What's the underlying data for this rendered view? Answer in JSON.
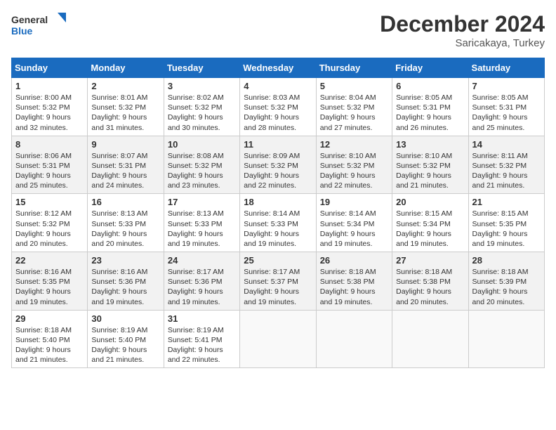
{
  "header": {
    "logo_line1": "General",
    "logo_line2": "Blue",
    "month": "December 2024",
    "location": "Saricakaya, Turkey"
  },
  "weekdays": [
    "Sunday",
    "Monday",
    "Tuesday",
    "Wednesday",
    "Thursday",
    "Friday",
    "Saturday"
  ],
  "weeks": [
    [
      {
        "day": "1",
        "lines": [
          "Sunrise: 8:00 AM",
          "Sunset: 5:32 PM",
          "Daylight: 9 hours",
          "and 32 minutes."
        ]
      },
      {
        "day": "2",
        "lines": [
          "Sunrise: 8:01 AM",
          "Sunset: 5:32 PM",
          "Daylight: 9 hours",
          "and 31 minutes."
        ]
      },
      {
        "day": "3",
        "lines": [
          "Sunrise: 8:02 AM",
          "Sunset: 5:32 PM",
          "Daylight: 9 hours",
          "and 30 minutes."
        ]
      },
      {
        "day": "4",
        "lines": [
          "Sunrise: 8:03 AM",
          "Sunset: 5:32 PM",
          "Daylight: 9 hours",
          "and 28 minutes."
        ]
      },
      {
        "day": "5",
        "lines": [
          "Sunrise: 8:04 AM",
          "Sunset: 5:32 PM",
          "Daylight: 9 hours",
          "and 27 minutes."
        ]
      },
      {
        "day": "6",
        "lines": [
          "Sunrise: 8:05 AM",
          "Sunset: 5:31 PM",
          "Daylight: 9 hours",
          "and 26 minutes."
        ]
      },
      {
        "day": "7",
        "lines": [
          "Sunrise: 8:05 AM",
          "Sunset: 5:31 PM",
          "Daylight: 9 hours",
          "and 25 minutes."
        ]
      }
    ],
    [
      {
        "day": "8",
        "lines": [
          "Sunrise: 8:06 AM",
          "Sunset: 5:31 PM",
          "Daylight: 9 hours",
          "and 25 minutes."
        ]
      },
      {
        "day": "9",
        "lines": [
          "Sunrise: 8:07 AM",
          "Sunset: 5:31 PM",
          "Daylight: 9 hours",
          "and 24 minutes."
        ]
      },
      {
        "day": "10",
        "lines": [
          "Sunrise: 8:08 AM",
          "Sunset: 5:32 PM",
          "Daylight: 9 hours",
          "and 23 minutes."
        ]
      },
      {
        "day": "11",
        "lines": [
          "Sunrise: 8:09 AM",
          "Sunset: 5:32 PM",
          "Daylight: 9 hours",
          "and 22 minutes."
        ]
      },
      {
        "day": "12",
        "lines": [
          "Sunrise: 8:10 AM",
          "Sunset: 5:32 PM",
          "Daylight: 9 hours",
          "and 22 minutes."
        ]
      },
      {
        "day": "13",
        "lines": [
          "Sunrise: 8:10 AM",
          "Sunset: 5:32 PM",
          "Daylight: 9 hours",
          "and 21 minutes."
        ]
      },
      {
        "day": "14",
        "lines": [
          "Sunrise: 8:11 AM",
          "Sunset: 5:32 PM",
          "Daylight: 9 hours",
          "and 21 minutes."
        ]
      }
    ],
    [
      {
        "day": "15",
        "lines": [
          "Sunrise: 8:12 AM",
          "Sunset: 5:32 PM",
          "Daylight: 9 hours",
          "and 20 minutes."
        ]
      },
      {
        "day": "16",
        "lines": [
          "Sunrise: 8:13 AM",
          "Sunset: 5:33 PM",
          "Daylight: 9 hours",
          "and 20 minutes."
        ]
      },
      {
        "day": "17",
        "lines": [
          "Sunrise: 8:13 AM",
          "Sunset: 5:33 PM",
          "Daylight: 9 hours",
          "and 19 minutes."
        ]
      },
      {
        "day": "18",
        "lines": [
          "Sunrise: 8:14 AM",
          "Sunset: 5:33 PM",
          "Daylight: 9 hours",
          "and 19 minutes."
        ]
      },
      {
        "day": "19",
        "lines": [
          "Sunrise: 8:14 AM",
          "Sunset: 5:34 PM",
          "Daylight: 9 hours",
          "and 19 minutes."
        ]
      },
      {
        "day": "20",
        "lines": [
          "Sunrise: 8:15 AM",
          "Sunset: 5:34 PM",
          "Daylight: 9 hours",
          "and 19 minutes."
        ]
      },
      {
        "day": "21",
        "lines": [
          "Sunrise: 8:15 AM",
          "Sunset: 5:35 PM",
          "Daylight: 9 hours",
          "and 19 minutes."
        ]
      }
    ],
    [
      {
        "day": "22",
        "lines": [
          "Sunrise: 8:16 AM",
          "Sunset: 5:35 PM",
          "Daylight: 9 hours",
          "and 19 minutes."
        ]
      },
      {
        "day": "23",
        "lines": [
          "Sunrise: 8:16 AM",
          "Sunset: 5:36 PM",
          "Daylight: 9 hours",
          "and 19 minutes."
        ]
      },
      {
        "day": "24",
        "lines": [
          "Sunrise: 8:17 AM",
          "Sunset: 5:36 PM",
          "Daylight: 9 hours",
          "and 19 minutes."
        ]
      },
      {
        "day": "25",
        "lines": [
          "Sunrise: 8:17 AM",
          "Sunset: 5:37 PM",
          "Daylight: 9 hours",
          "and 19 minutes."
        ]
      },
      {
        "day": "26",
        "lines": [
          "Sunrise: 8:18 AM",
          "Sunset: 5:38 PM",
          "Daylight: 9 hours",
          "and 19 minutes."
        ]
      },
      {
        "day": "27",
        "lines": [
          "Sunrise: 8:18 AM",
          "Sunset: 5:38 PM",
          "Daylight: 9 hours",
          "and 20 minutes."
        ]
      },
      {
        "day": "28",
        "lines": [
          "Sunrise: 8:18 AM",
          "Sunset: 5:39 PM",
          "Daylight: 9 hours",
          "and 20 minutes."
        ]
      }
    ],
    [
      {
        "day": "29",
        "lines": [
          "Sunrise: 8:18 AM",
          "Sunset: 5:40 PM",
          "Daylight: 9 hours",
          "and 21 minutes."
        ]
      },
      {
        "day": "30",
        "lines": [
          "Sunrise: 8:19 AM",
          "Sunset: 5:40 PM",
          "Daylight: 9 hours",
          "and 21 minutes."
        ]
      },
      {
        "day": "31",
        "lines": [
          "Sunrise: 8:19 AM",
          "Sunset: 5:41 PM",
          "Daylight: 9 hours",
          "and 22 minutes."
        ]
      },
      null,
      null,
      null,
      null
    ]
  ]
}
